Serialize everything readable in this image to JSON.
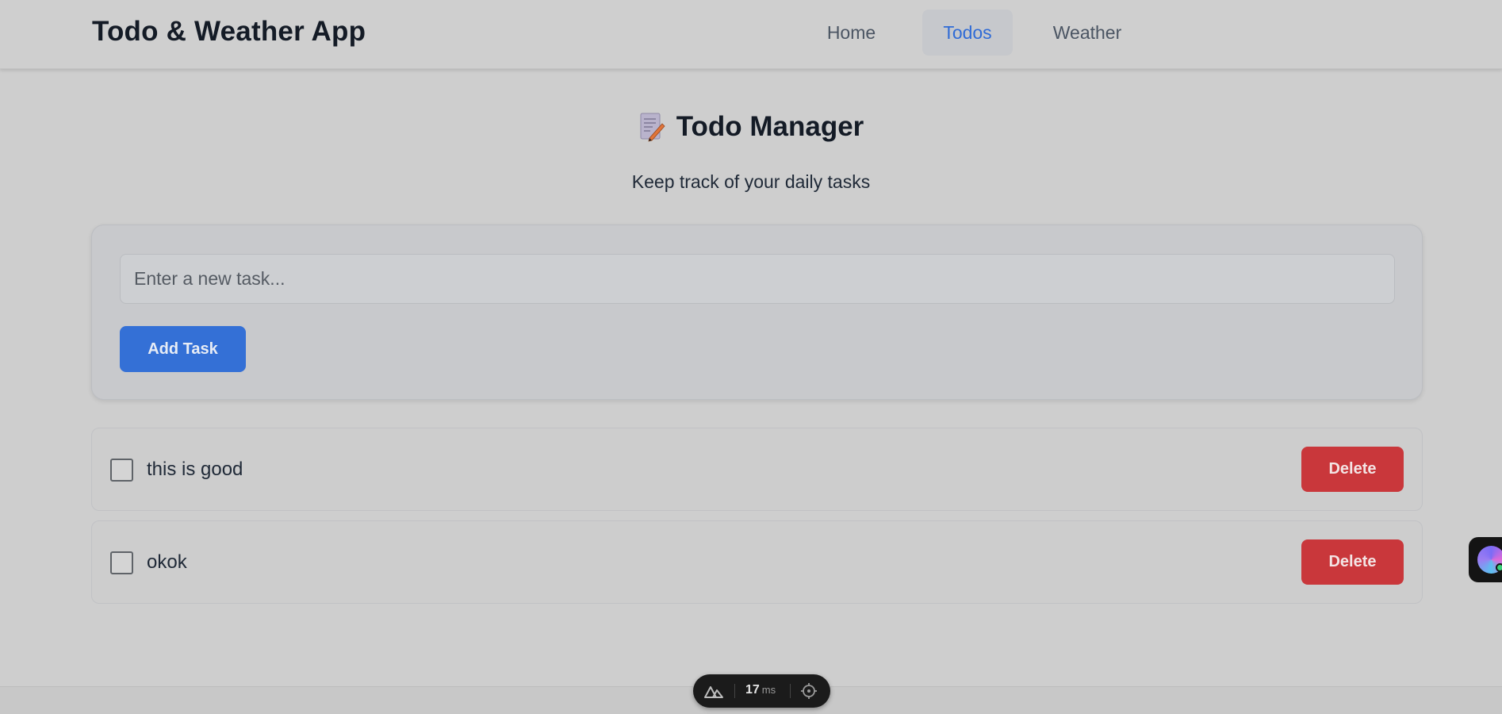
{
  "header": {
    "app_title": "Todo & Weather App",
    "nav": [
      {
        "label": "Home",
        "active": false
      },
      {
        "label": "Todos",
        "active": true
      },
      {
        "label": "Weather",
        "active": false
      }
    ]
  },
  "main": {
    "icon": "memo-icon",
    "title": "Todo Manager",
    "subtitle": "Keep track of your daily tasks",
    "input_placeholder": "Enter a new task...",
    "input_value": "",
    "add_button_label": "Add Task",
    "todos": [
      {
        "text": "this is good",
        "done": false,
        "delete_label": "Delete"
      },
      {
        "text": "okok",
        "done": false,
        "delete_label": "Delete"
      }
    ]
  },
  "devtools": {
    "logo": "nuxt-logo-icon",
    "render_time": "17",
    "render_unit": "ms",
    "inspect_icon": "crosshair-icon"
  },
  "colors": {
    "accent": "#3470d6",
    "danger": "#c9373b",
    "active_nav_text": "#2f6bd6"
  }
}
